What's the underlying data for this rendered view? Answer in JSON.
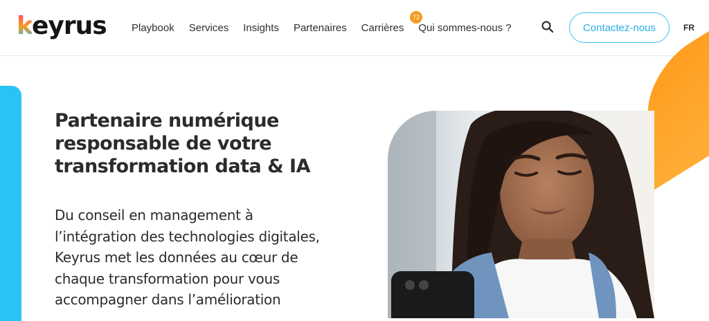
{
  "brand": {
    "logo_k": "k",
    "logo_rest": "eyrus"
  },
  "nav": {
    "items": [
      {
        "label": "Playbook"
      },
      {
        "label": "Services"
      },
      {
        "label": "Insights"
      },
      {
        "label": "Partenaires"
      },
      {
        "label": "Carrières"
      },
      {
        "label": "Qui sommes-nous ?"
      }
    ],
    "careers_badge": "72"
  },
  "header": {
    "cta_label": "Contactez-nous",
    "lang_label": "FR"
  },
  "hero": {
    "headline": "Partenaire numérique responsable de votre transformation data & IA",
    "body": "Du conseil en management à l’intégration des technologies digitales, Keyrus met les données au cœur de chaque transformation pour vous accompagner dans l’amélioration"
  },
  "colors": {
    "accent_blue": "#29c3f5",
    "accent_orange": "#ff9d1f",
    "cta_blue": "#2aaee6",
    "badge_orange": "#f59a23"
  },
  "icons": {
    "search": "search-icon"
  }
}
